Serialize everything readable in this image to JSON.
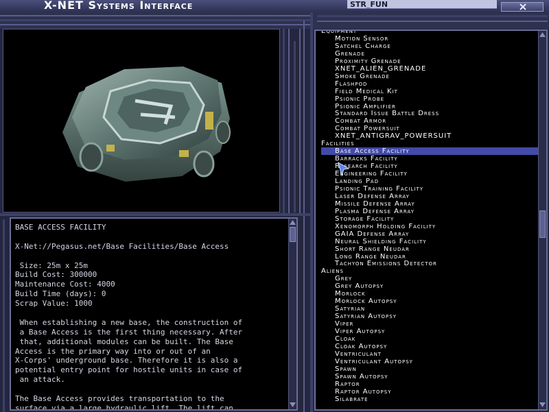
{
  "window": {
    "title": "X-NET Systems Interface",
    "field_text": "STR_FUN"
  },
  "colors": {
    "frame": "#2e3250",
    "accent": "#434aa8",
    "panel_bg": "#000000",
    "text": "#ffffff"
  },
  "icons": {
    "close": "close-icon",
    "scroll_up": "arrow-up-icon",
    "scroll_down": "arrow-down-icon",
    "cursor": "mouse-pointer-icon"
  },
  "description": {
    "lines": [
      "BASE ACCESS FACILITY",
      "",
      "X-Net://Pegasus.net/Base Facilities/Base Access",
      "",
      " Size: 25m x 25m",
      "Build Cost: 300000",
      "Maintenance Cost: 4000",
      "Build Time (days): 0",
      "Scrap Value: 1000",
      "",
      " When establishing a new base, the construction of",
      " a Base Access is the first thing necessary. After",
      " that, additional modules can be built. The Base",
      "Access is the primary way into or out of an",
      "X-Corps' underground base. Therefore it is also a",
      "potential entry point for hostile units in case of",
      " an attack.",
      "",
      "The Base Access provides transportation to the",
      "surface via a large hydraulic lift. The lift can"
    ]
  },
  "tree": [
    {
      "type": "cat",
      "label": "Equipment"
    },
    {
      "type": "item",
      "label": "Motion Sensor"
    },
    {
      "type": "item",
      "label": "Satchel Charge"
    },
    {
      "type": "item",
      "label": "Grenade"
    },
    {
      "type": "item",
      "label": "Proximity Grenade"
    },
    {
      "type": "item",
      "label": "XNET_ALIEN_GRENADE"
    },
    {
      "type": "item",
      "label": "Smoke Grenade"
    },
    {
      "type": "item",
      "label": "Flashpod"
    },
    {
      "type": "item",
      "label": "Field Medical Kit"
    },
    {
      "type": "item",
      "label": "Psionic Probe"
    },
    {
      "type": "item",
      "label": "Psionic Amplifier"
    },
    {
      "type": "item",
      "label": "Standard Issue Battle Dress"
    },
    {
      "type": "item",
      "label": "Combat Armor"
    },
    {
      "type": "item",
      "label": "Combat Powersuit"
    },
    {
      "type": "item",
      "label": "XNET_ANTIGRAV_POWERSUIT"
    },
    {
      "type": "cat",
      "label": "Facilities"
    },
    {
      "type": "item",
      "label": "Base Access Facility",
      "selected": true
    },
    {
      "type": "item",
      "label": "Barracks Facility"
    },
    {
      "type": "item",
      "label": "Research Facility"
    },
    {
      "type": "item",
      "label": "Engineering Facility"
    },
    {
      "type": "item",
      "label": "Landing Pad"
    },
    {
      "type": "item",
      "label": "Psionic Training Facility"
    },
    {
      "type": "item",
      "label": "Laser Defense Array"
    },
    {
      "type": "item",
      "label": "Missile Defense Array"
    },
    {
      "type": "item",
      "label": "Plasma Defense Array"
    },
    {
      "type": "item",
      "label": "Storage Facility"
    },
    {
      "type": "item",
      "label": "Xenomorph Holding Facility"
    },
    {
      "type": "item",
      "label": "GAIA Defense Array"
    },
    {
      "type": "item",
      "label": "Neural Shielding Facility"
    },
    {
      "type": "item",
      "label": "Short Range Neudar"
    },
    {
      "type": "item",
      "label": "Long Range Neudar"
    },
    {
      "type": "item",
      "label": "Tachyon Emissions Detector"
    },
    {
      "type": "cat",
      "label": "Aliens"
    },
    {
      "type": "item",
      "label": "Grey"
    },
    {
      "type": "item",
      "label": "Grey Autopsy"
    },
    {
      "type": "item",
      "label": "Morlock"
    },
    {
      "type": "item",
      "label": "Morlock Autopsy"
    },
    {
      "type": "item",
      "label": "Satyrian"
    },
    {
      "type": "item",
      "label": "Satyrian Autopsy"
    },
    {
      "type": "item",
      "label": "Viper"
    },
    {
      "type": "item",
      "label": "Viper Autopsy"
    },
    {
      "type": "item",
      "label": "Cloak"
    },
    {
      "type": "item",
      "label": "Cloak Autopsy"
    },
    {
      "type": "item",
      "label": "Ventriculant"
    },
    {
      "type": "item",
      "label": "Ventriculant Autopsy"
    },
    {
      "type": "item",
      "label": "Spawn"
    },
    {
      "type": "item",
      "label": "Spawn Autopsy"
    },
    {
      "type": "item",
      "label": "Raptor"
    },
    {
      "type": "item",
      "label": "Raptor Autopsy"
    },
    {
      "type": "item",
      "label": "Silabrate"
    }
  ]
}
